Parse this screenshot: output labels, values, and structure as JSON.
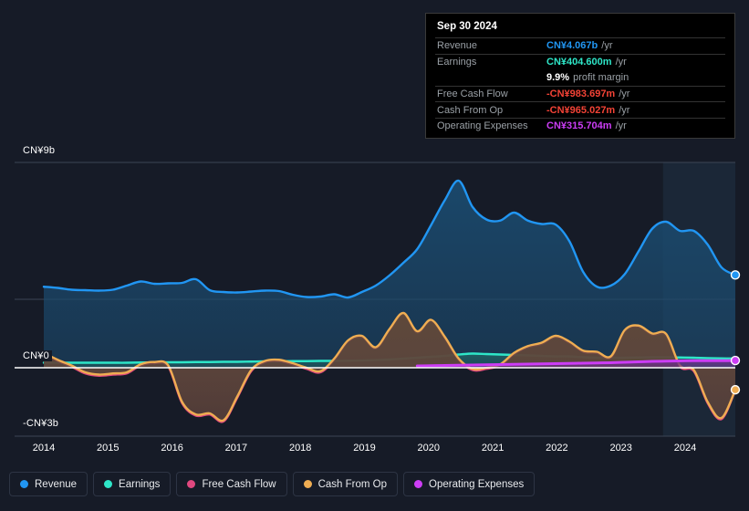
{
  "chart_data": {
    "type": "area",
    "title": "",
    "xlabel": "",
    "ylabel": "",
    "grid": true,
    "legend_position": "bottom",
    "currency": "CN¥",
    "ylim": [
      -3,
      9
    ],
    "y_ticks": [
      {
        "value": 9,
        "label": "CN¥9b"
      },
      {
        "value": 0,
        "label": "CN¥0"
      },
      {
        "value": -3,
        "label": "-CN¥3b"
      }
    ],
    "x_ticks": [
      "2014",
      "2015",
      "2016",
      "2017",
      "2018",
      "2019",
      "2020",
      "2021",
      "2022",
      "2023",
      "2024"
    ],
    "xlim": [
      "2013.75",
      "2024.75"
    ],
    "series": [
      {
        "name": "Revenue",
        "color": "#2196f3",
        "fill": "#1b4a6e",
        "values": [
          3.55,
          3.5,
          3.42,
          3.4,
          3.38,
          3.42,
          3.6,
          3.78,
          3.68,
          3.7,
          3.72,
          3.88,
          3.4,
          3.32,
          3.3,
          3.34,
          3.38,
          3.36,
          3.2,
          3.1,
          3.12,
          3.22,
          3.08,
          3.32,
          3.6,
          4.05,
          4.6,
          5.2,
          6.25,
          7.35,
          8.2,
          7.05,
          6.5,
          6.45,
          6.8,
          6.45,
          6.3,
          6.28,
          5.55,
          4.2,
          3.55,
          3.6,
          4.1,
          5.1,
          6.1,
          6.4,
          6.0,
          6.0,
          5.4,
          4.4,
          4.07
        ]
      },
      {
        "name": "Earnings",
        "color": "#2ee6c8",
        "fill": "#1f5f62",
        "values": [
          0.22,
          0.22,
          0.22,
          0.22,
          0.22,
          0.22,
          0.22,
          0.23,
          0.23,
          0.24,
          0.24,
          0.25,
          0.25,
          0.26,
          0.26,
          0.27,
          0.28,
          0.28,
          0.29,
          0.29,
          0.3,
          0.3,
          0.31,
          0.32,
          0.34,
          0.36,
          0.4,
          0.44,
          0.48,
          0.52,
          0.58,
          0.62,
          0.6,
          0.58,
          0.56,
          0.54,
          0.52,
          0.5,
          0.5,
          0.46,
          0.44,
          0.44,
          0.44,
          0.45,
          0.46,
          0.46,
          0.45,
          0.44,
          0.42,
          0.41,
          0.4046
        ]
      },
      {
        "name": "Free Cash Flow",
        "color": "#e0487f",
        "fill": "#5e3340",
        "values": [
          0.6,
          0.3,
          0.05,
          -0.25,
          -0.35,
          -0.3,
          -0.25,
          0.1,
          0.2,
          0.05,
          -1.55,
          -2.1,
          -2.05,
          -2.35,
          -1.3,
          -0.15,
          0.25,
          0.3,
          0.15,
          -0.05,
          -0.2,
          0.35,
          1.15,
          1.35,
          0.85,
          1.65,
          2.35,
          1.55,
          2.05,
          1.3,
          0.35,
          -0.1,
          -0.05,
          0.1,
          0.6,
          0.9,
          1.05,
          1.35,
          1.1,
          0.7,
          0.65,
          0.45,
          1.6,
          1.8,
          1.45,
          1.42,
          0.05,
          -0.15,
          -1.55,
          -2.25,
          -0.984
        ]
      },
      {
        "name": "Cash From Op",
        "color": "#efad52",
        "fill": "#5e4a3a",
        "values": [
          0.65,
          0.35,
          0.1,
          -0.2,
          -0.3,
          -0.25,
          -0.2,
          0.15,
          0.25,
          0.1,
          -1.5,
          -2.05,
          -2.0,
          -2.3,
          -1.25,
          -0.1,
          0.3,
          0.35,
          0.2,
          0.0,
          -0.15,
          0.4,
          1.2,
          1.4,
          0.9,
          1.7,
          2.4,
          1.6,
          2.1,
          1.35,
          0.4,
          -0.05,
          0.0,
          0.15,
          0.65,
          0.95,
          1.1,
          1.4,
          1.15,
          0.75,
          0.7,
          0.5,
          1.65,
          1.85,
          1.5,
          1.48,
          0.1,
          -0.1,
          -1.5,
          -2.2,
          -0.965
        ]
      },
      {
        "name": "Operating Expenses",
        "color": "#cc3df5",
        "fill": "#6b2d8a",
        "values": [
          null,
          null,
          null,
          null,
          null,
          null,
          null,
          null,
          null,
          null,
          null,
          null,
          null,
          null,
          null,
          null,
          null,
          null,
          null,
          null,
          null,
          null,
          null,
          null,
          null,
          null,
          null,
          0.08,
          0.09,
          0.1,
          0.11,
          0.12,
          0.13,
          0.14,
          0.15,
          0.16,
          0.17,
          0.18,
          0.19,
          0.2,
          0.21,
          0.22,
          0.24,
          0.26,
          0.28,
          0.29,
          0.3,
          0.31,
          0.31,
          0.31,
          0.3157
        ]
      }
    ],
    "highlight_band": {
      "from": "2023.6",
      "to": "2024.75"
    },
    "endpoint_markers": [
      {
        "series": "Revenue",
        "value": 4.067
      },
      {
        "series": "Operating Expenses",
        "value": 0.3157
      },
      {
        "series": "Cash From Op",
        "value": -0.965
      }
    ]
  },
  "tooltip": {
    "date": "Sep 30 2024",
    "rows": [
      {
        "label": "Revenue",
        "value": "CN¥4.067b",
        "unit": "/yr",
        "color": "#2196f3"
      },
      {
        "label": "Earnings",
        "value": "CN¥404.600m",
        "unit": "/yr",
        "color": "#2ee6c8"
      },
      {
        "label": "",
        "value": "9.9%",
        "unit": "profit margin",
        "color": "#ffffff"
      },
      {
        "label": "Free Cash Flow",
        "value": "-CN¥983.697m",
        "unit": "/yr",
        "color": "#f44336"
      },
      {
        "label": "Cash From Op",
        "value": "-CN¥965.027m",
        "unit": "/yr",
        "color": "#f44336"
      },
      {
        "label": "Operating Expenses",
        "value": "CN¥315.704m",
        "unit": "/yr",
        "color": "#cc3df5"
      }
    ]
  },
  "legend": {
    "items": [
      {
        "label": "Revenue",
        "color": "#2196f3"
      },
      {
        "label": "Earnings",
        "color": "#2ee6c8"
      },
      {
        "label": "Free Cash Flow",
        "color": "#e0487f"
      },
      {
        "label": "Cash From Op",
        "color": "#efad52"
      },
      {
        "label": "Operating Expenses",
        "color": "#cc3df5"
      }
    ]
  }
}
